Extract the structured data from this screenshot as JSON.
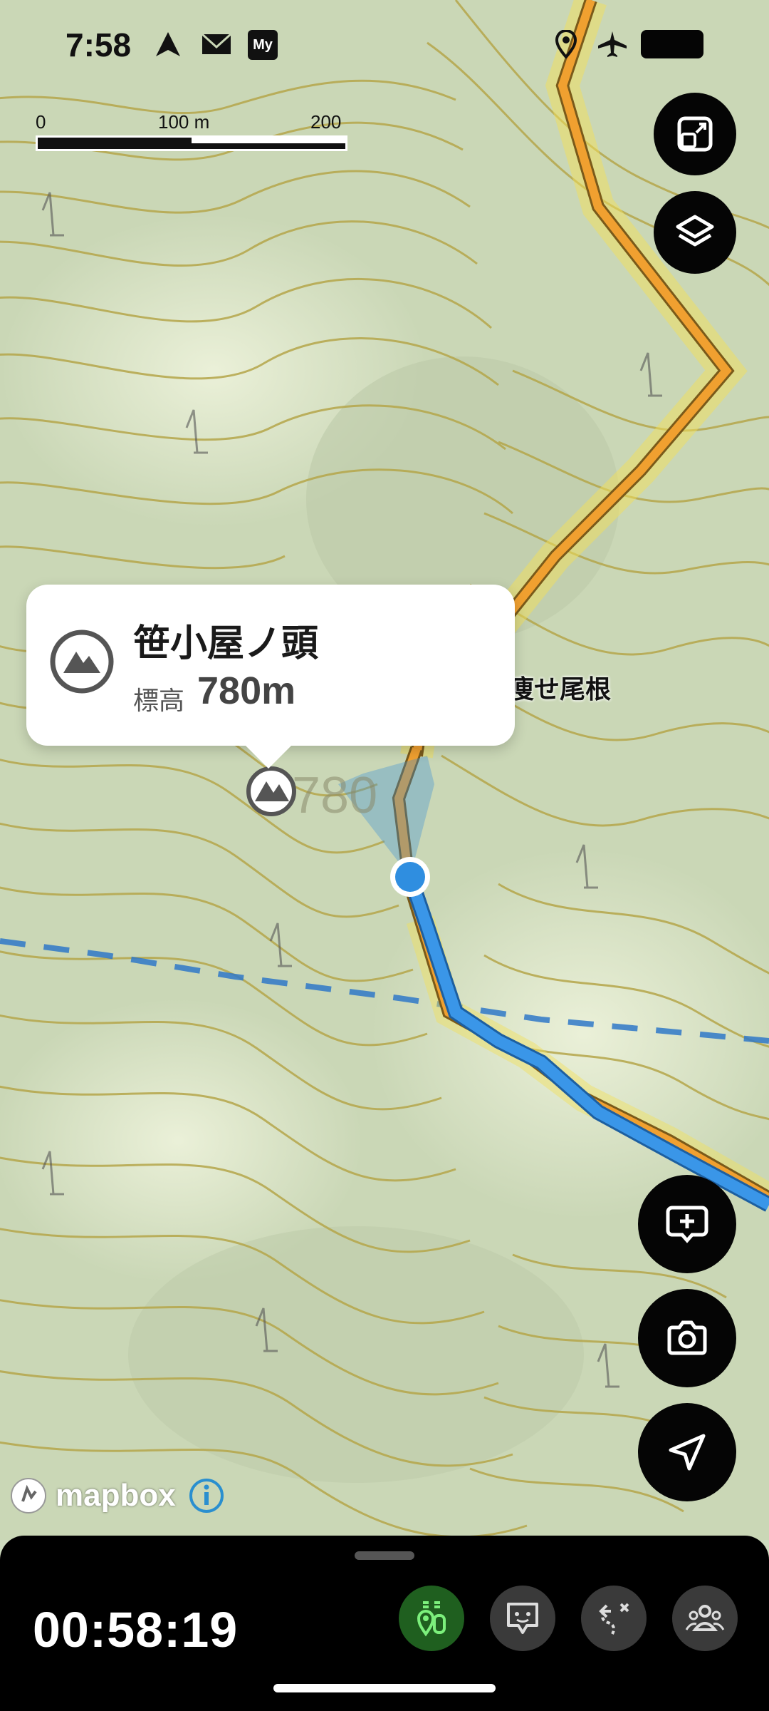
{
  "status_bar": {
    "time": "7:58",
    "icons": [
      "navigation-arrow-icon",
      "mail-icon",
      "my-app-icon",
      "location-pin-icon",
      "airplane-mode-icon",
      "battery-icon"
    ],
    "my_badge": "My"
  },
  "scale_bar": {
    "labels": [
      "0",
      "100 m",
      "200 m"
    ]
  },
  "map": {
    "summit_number": "780",
    "ridge_label": "痩せ尾根"
  },
  "popup": {
    "title": "笹小屋ノ頭",
    "elevation_label": "標高",
    "elevation_value": "780m",
    "icon": "mountain-icon"
  },
  "map_controls": [
    "fullscreen-icon",
    "layers-icon",
    "add-note-icon",
    "camera-icon",
    "navigate-arrow-icon"
  ],
  "attribution": {
    "logo_text": "mapbox",
    "info_icon": "info-icon"
  },
  "bottom_panel": {
    "timer": "00:58:19",
    "tabs": [
      {
        "icon": "activity-gps-icon",
        "active": true
      },
      {
        "icon": "message-icon",
        "active": false
      },
      {
        "icon": "route-icon",
        "active": false
      },
      {
        "icon": "group-icon",
        "active": false
      }
    ]
  },
  "colors": {
    "trail": "#f0a030",
    "route": "#2f8ee0",
    "location": "#2f8ee0",
    "fab": "#050505",
    "active_tab": "#2a8a2a",
    "contour": "#b5a64a"
  }
}
